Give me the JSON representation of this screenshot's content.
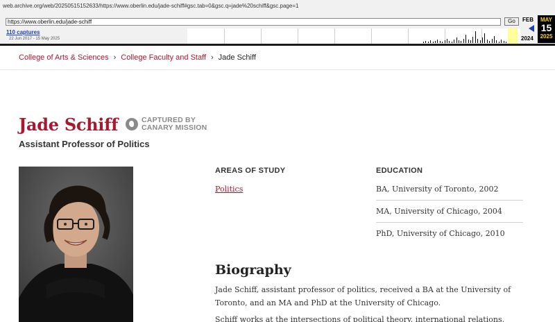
{
  "wayback": {
    "archive_url": "web.archive.org/web/20250515152633/https://www.oberlin.edu/jade-schiff#gsc.tab=0&gsc.q=jade%20schiff&gsc.page=1",
    "input_value": "https://www.oberlin.edu/jade-schiff",
    "go_label": "Go",
    "captures_label": "110 captures",
    "date_range": "22 Jun 2017 - 15 May 2025",
    "prev_month": "FEB",
    "prev_year": "2024",
    "cur_month": "MAY",
    "cur_day": "15",
    "cur_year": "2025"
  },
  "breadcrumb": {
    "items": [
      "College of Arts & Sciences",
      "College Faculty and Staff"
    ],
    "current": "Jade Schiff",
    "separator": "›"
  },
  "profile": {
    "name": "Jade Schiff",
    "title": "Assistant Professor of Politics",
    "watermark_line1": "CAPTURED BY",
    "watermark_line2": "CANARY MISSION"
  },
  "areas": {
    "heading": "AREAS OF STUDY",
    "items": [
      "Politics"
    ]
  },
  "education": {
    "heading": "EDUCATION",
    "items": [
      "BA, University of Toronto, 2002",
      "MA, University of Chicago, 2004",
      "PhD, University of Chicago, 2010"
    ]
  },
  "biography": {
    "heading": "Biography",
    "paragraphs": [
      "Jade Schiff, assistant professor of politics, received a BA at the University of Toronto, and an MA and PhD at the University of Chicago.",
      "Schiff works at the intersections of political theory, international relations,"
    ]
  },
  "colors": {
    "brand": "#a6192e",
    "wayback_link": "#1b3fb5",
    "calendar_bg": "#000000",
    "calendar_text": "#ffd400"
  }
}
